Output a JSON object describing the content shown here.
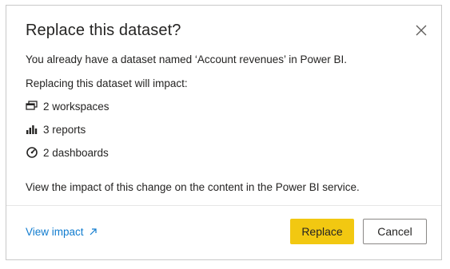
{
  "dialog": {
    "title": "Replace this dataset?",
    "message": "You already have a dataset named ‘Account revenues’ in Power BI.",
    "impact_intro": "Replacing this dataset will impact:",
    "impacts": [
      {
        "icon": "workspaces-icon",
        "label": "2 workspaces"
      },
      {
        "icon": "reports-icon",
        "label": "3 reports"
      },
      {
        "icon": "dashboards-icon",
        "label": "2 dashboards"
      }
    ],
    "footer_note": "View the impact of this change on the content in the Power BI service.",
    "view_impact_link": "View impact",
    "replace_label": "Replace",
    "cancel_label": "Cancel"
  },
  "colors": {
    "primary_button": "#f2c811",
    "link": "#117ccf",
    "text": "#252423"
  }
}
